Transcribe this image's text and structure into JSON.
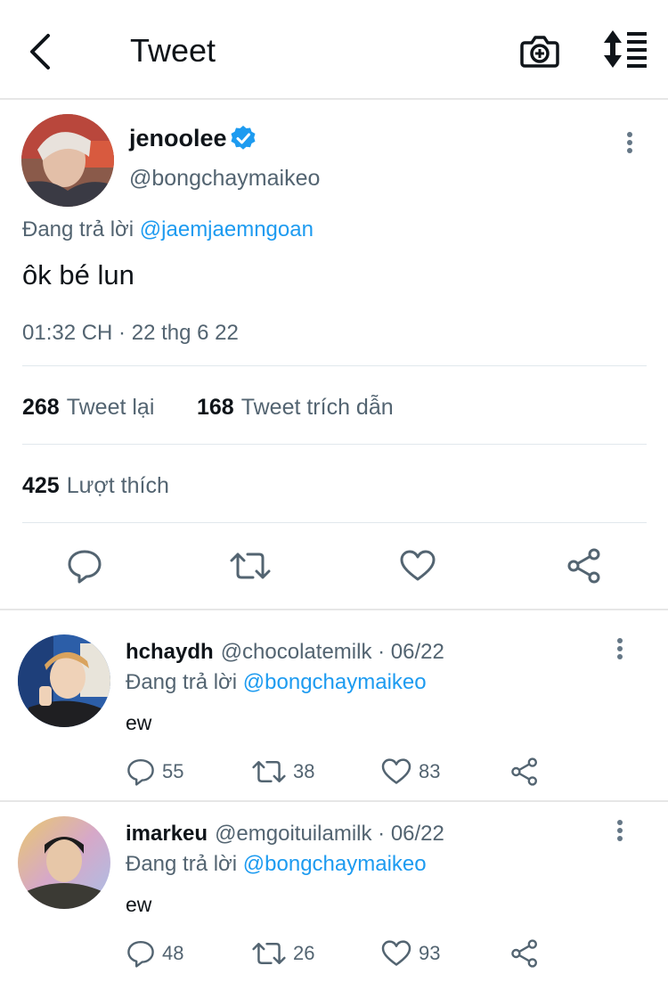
{
  "header": {
    "title": "Tweet",
    "back_icon": "chevron-left-icon",
    "camera_icon": "camera-plus-icon",
    "sort_icon": "sort-icon"
  },
  "tweet": {
    "name": "jenoolee",
    "handle": "@bongchaymaikeo",
    "replying_prefix": "Đang trả lời",
    "replying_to": "@jaemjaemngoan",
    "text": "ôk bé lun",
    "timestamp": "01:32 CH · 22 thg 6 22",
    "retweets_count": "268",
    "retweets_label": "Tweet lại",
    "quotes_count": "168",
    "quotes_label": "Tweet trích dẫn",
    "likes_count": "425",
    "likes_label": "Lượt thích"
  },
  "replies": [
    {
      "name": "hchaydh",
      "handle": "@chocolatemilk",
      "date": "· 06/22",
      "replying_prefix": "Đang trả lời",
      "replying_to": "@bongchaymaikeo",
      "text": "ew",
      "replies": "55",
      "retweets": "38",
      "likes": "83"
    },
    {
      "name": "imarkeu",
      "handle": "@emgoituilamilk",
      "date": "· 06/22",
      "replying_prefix": "Đang trả lời",
      "replying_to": "@bongchaymaikeo",
      "text": "ew",
      "replies": "48",
      "retweets": "26",
      "likes": "93"
    }
  ],
  "colors": {
    "accent": "#1d9bf0",
    "secondary_text": "#536471",
    "verified": "#1d9bf0"
  }
}
